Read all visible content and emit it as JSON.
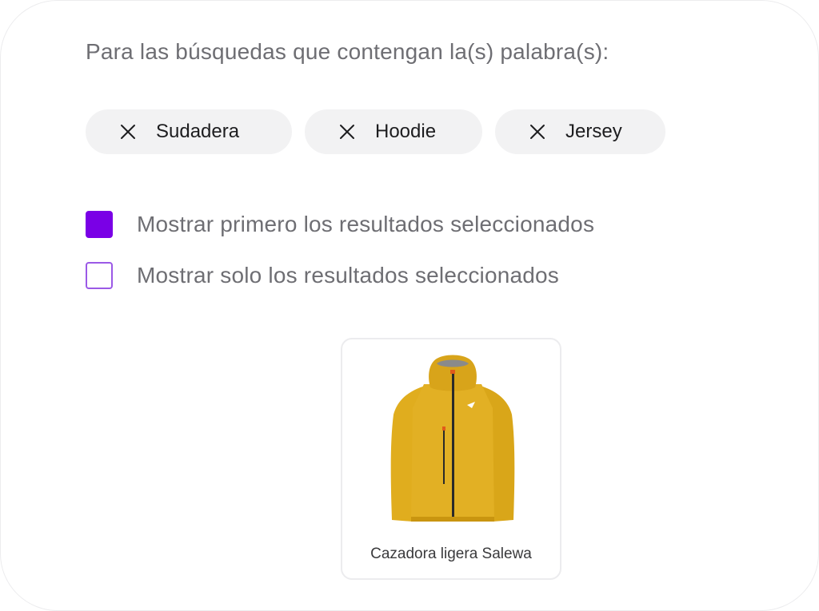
{
  "heading": "Para las búsquedas que contengan la(s) palabra(s):",
  "keywords": [
    {
      "label": "Sudadera",
      "icon": "close-icon"
    },
    {
      "label": "Hoodie",
      "icon": "close-icon"
    },
    {
      "label": "Jersey",
      "icon": "close-icon"
    }
  ],
  "options": [
    {
      "label": "Mostrar primero los resultados seleccionados",
      "checked": true
    },
    {
      "label": "Mostrar solo los resultados seleccionados",
      "checked": false
    }
  ],
  "product": {
    "name": "Cazadora ligera Salewa",
    "image": "yellow-jacket-image"
  },
  "colors": {
    "accent": "#7a00e6",
    "chip_bg": "#f2f2f3",
    "jacket": "#e0ad1e"
  }
}
